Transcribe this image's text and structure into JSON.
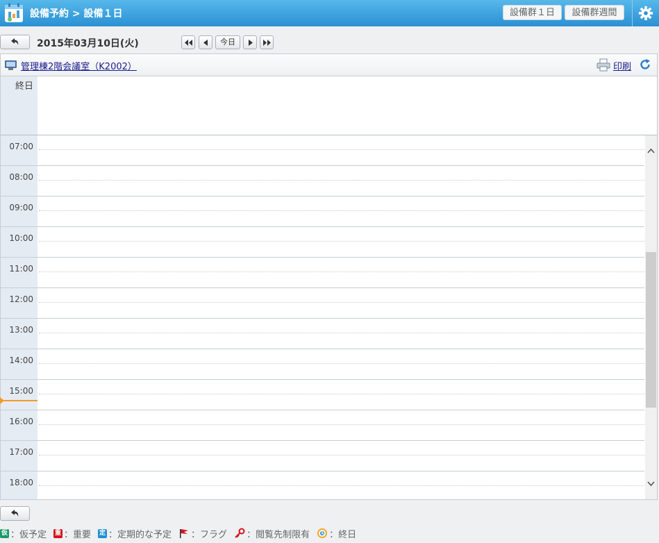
{
  "header": {
    "title": "設備予約 > 設備１日",
    "day_button": "設備群１日",
    "week_button": "設備群週間"
  },
  "toolbar": {
    "date": "2015年03月10日(火)",
    "today": "今日"
  },
  "facility": {
    "name": "管理棟2階会議室（K2002）",
    "print": "印刷"
  },
  "schedule": {
    "allday_label": "終日",
    "hours": [
      "07:00",
      "08:00",
      "09:00",
      "10:00",
      "11:00",
      "12:00",
      "13:00",
      "14:00",
      "15:00",
      "16:00",
      "17:00",
      "18:00"
    ]
  },
  "legend": [
    {
      "badge": "仮",
      "color": "#1a9a6a",
      "label": "：仮予定"
    },
    {
      "badge": "重",
      "color": "#d2141c",
      "label": "：重要"
    },
    {
      "badge": "定",
      "color": "#1f8fd0",
      "label": "：定期的な予定"
    },
    {
      "icon": "flag-icon",
      "label": "：フラグ"
    },
    {
      "icon": "key-icon",
      "label": "：閲覧先制限有"
    },
    {
      "icon": "clock-icon",
      "label": "：終日"
    }
  ],
  "colors": {
    "header_blue": "#2a90d4",
    "now_line": "#f39a2a",
    "time_column": "#e5ebf2"
  }
}
